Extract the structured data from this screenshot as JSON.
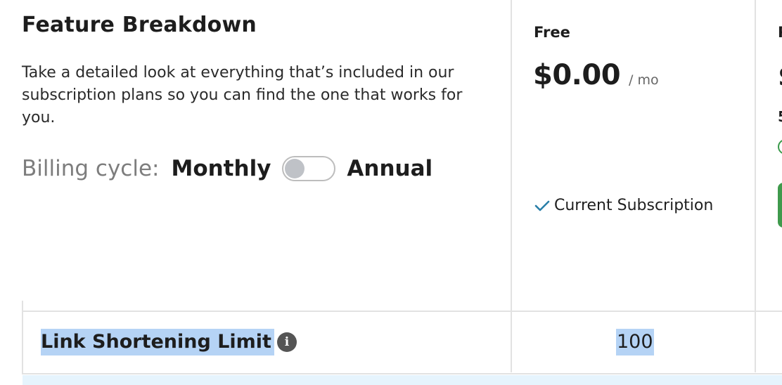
{
  "section": {
    "title": "Feature Breakdown",
    "description": "Take a detailed look at everything that’s included in our subscription plans so you can find the one that works for you."
  },
  "billing": {
    "label": "Billing cycle:",
    "option_monthly": "Monthly",
    "option_annual": "Annual",
    "annual_enabled": false
  },
  "plans": [
    {
      "name": "Free",
      "price": "$0.00",
      "period": "/ mo",
      "status": "Current Subscription"
    }
  ],
  "features": [
    {
      "label": "Link Shortening Limit",
      "info_icon": "info-icon",
      "values": [
        "100"
      ]
    }
  ],
  "colors": {
    "accent_check": "#2a7fa8",
    "selection_highlight": "#b5d3f5",
    "upgrade_green": "#3f9a4c",
    "row_alt_bg": "#e6f4fd"
  }
}
